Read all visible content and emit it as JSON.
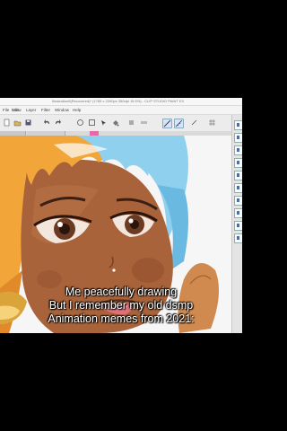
{
  "window": {
    "title": "Illustration8(Recovered)* (1765 x 2200px 350dpi 15.5%) - CLIP STUDIO PAINT EX"
  },
  "menu": {
    "items": [
      "File",
      "Edit",
      "View",
      "Layer",
      "Filter",
      "Window",
      "Help"
    ]
  },
  "toolbar": {
    "icons": [
      "new-icon",
      "open-icon",
      "save-icon",
      "undo-icon",
      "redo-icon",
      "clear-icon",
      "transform-icon",
      "select-icon",
      "fill-icon",
      "pen-icon",
      "pencil-icon",
      "eraser-icon",
      "ruler-icon",
      "snap-icon",
      "grid-icon"
    ]
  },
  "canvas": {
    "artwork": "anime-girl-portrait"
  },
  "right_panel": {
    "buttons": 10
  },
  "caption": {
    "line1": "Me peacefully drawing",
    "line2": "But I remember my old dsmp",
    "line3": "Animation memes from 2021:"
  },
  "colors": {
    "skin": "#a8633a",
    "hair_orange": "#f2a63a",
    "hair_blue": "#8fd0ee",
    "ui_bg": "#ececec"
  }
}
